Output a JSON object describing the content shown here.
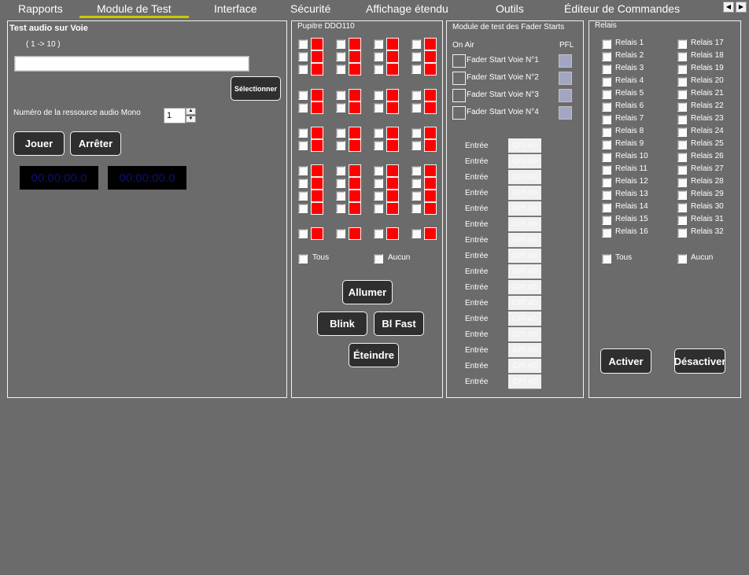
{
  "tabs": [
    {
      "label": "Rapports",
      "active": false
    },
    {
      "label": "Module de Test",
      "active": true
    },
    {
      "label": "Interface",
      "active": false
    },
    {
      "label": "Sécurité",
      "active": false
    },
    {
      "label": "Affichage étendu",
      "active": false
    },
    {
      "label": "Outils",
      "active": false
    },
    {
      "label": "Éditeur de Commandes",
      "active": false
    }
  ],
  "tab_scroll": {
    "left": "◀",
    "right": "▶"
  },
  "audio_test": {
    "title": "Test audio sur Voie",
    "range_hint": "( 1 -> 10 )",
    "voie_input_value": "",
    "select_button": "Sélectionner",
    "mono_label": "Numéro de la ressource audio Mono",
    "mono_value": "1",
    "spin_up": "▲",
    "spin_down": "▼",
    "play_button": "Jouer",
    "stop_button": "Arrêter",
    "timer_1": "00:00:00.0",
    "timer_2": "00:00:00.0"
  },
  "pupitre": {
    "title": "Pupitre DDO110",
    "group_rows": [
      3,
      2,
      2,
      4,
      1
    ],
    "columns": 4,
    "led_color": "#ff0000",
    "all_label": "Tous",
    "none_label": "Aucun",
    "on_button": "Allumer",
    "blink_button": "Blink",
    "blink_fast_button": "Bl Fast",
    "off_button": "Éteindre"
  },
  "fader": {
    "title": "Module de test des Fader Starts",
    "on_air_header": "On Air",
    "pfl_header": "PFL",
    "rows": [
      "Fader Start Voie N°1",
      "Fader Start Voie N°2",
      "Fader Start Voie N°3",
      "Fader Start Voie N°4"
    ],
    "pfl_color": "#a2a6c2",
    "inputs": [
      {
        "label": "Entrée",
        "value": "GPI #0"
      },
      {
        "label": "Entrée",
        "value": "GPI #0"
      },
      {
        "label": "Entrée",
        "value": "GPI #0"
      },
      {
        "label": "Entrée",
        "value": "GPI #0"
      },
      {
        "label": "Entrée",
        "value": "GPI #0"
      },
      {
        "label": "Entrée",
        "value": "GPI #0"
      },
      {
        "label": "Entrée",
        "value": "GPI #0"
      },
      {
        "label": "Entrée",
        "value": "GPI #0"
      },
      {
        "label": "Entrée",
        "value": "GPI #0"
      },
      {
        "label": "Entrée",
        "value": "GPI #0"
      },
      {
        "label": "Entrée",
        "value": "GPI #0"
      },
      {
        "label": "Entrée",
        "value": "GPI #0"
      },
      {
        "label": "Entrée",
        "value": "GPI #0"
      },
      {
        "label": "Entrée",
        "value": "GPI #0"
      },
      {
        "label": "Entrée",
        "value": "GPI #0"
      },
      {
        "label": "Entrée",
        "value": "GPI #0"
      }
    ]
  },
  "relais": {
    "title": "Relais",
    "items": [
      "Relais 1",
      "Relais 2",
      "Relais 3",
      "Relais 4",
      "Relais 5",
      "Relais 6",
      "Relais 7",
      "Relais 8",
      "Relais 9",
      "Relais 10",
      "Relais 11",
      "Relais 12",
      "Relais 13",
      "Relais 14",
      "Relais 15",
      "Relais 16",
      "Relais 17",
      "Relais 18",
      "Relais 19",
      "Relais 20",
      "Relais 21",
      "Relais 22",
      "Relais 23",
      "Relais 24",
      "Relais 25",
      "Relais 26",
      "Relais 27",
      "Relais 28",
      "Relais 29",
      "Relais 30",
      "Relais 31",
      "Relais 32"
    ],
    "all_label": "Tous",
    "none_label": "Aucun",
    "activate_button": "Activer",
    "deactivate_button": "Désactiver"
  },
  "colors": {
    "background": "#6b6b6b",
    "active_tab_underline": "#c8c800",
    "button_bg": "#2f2f2f",
    "timer_text": "#101070"
  }
}
